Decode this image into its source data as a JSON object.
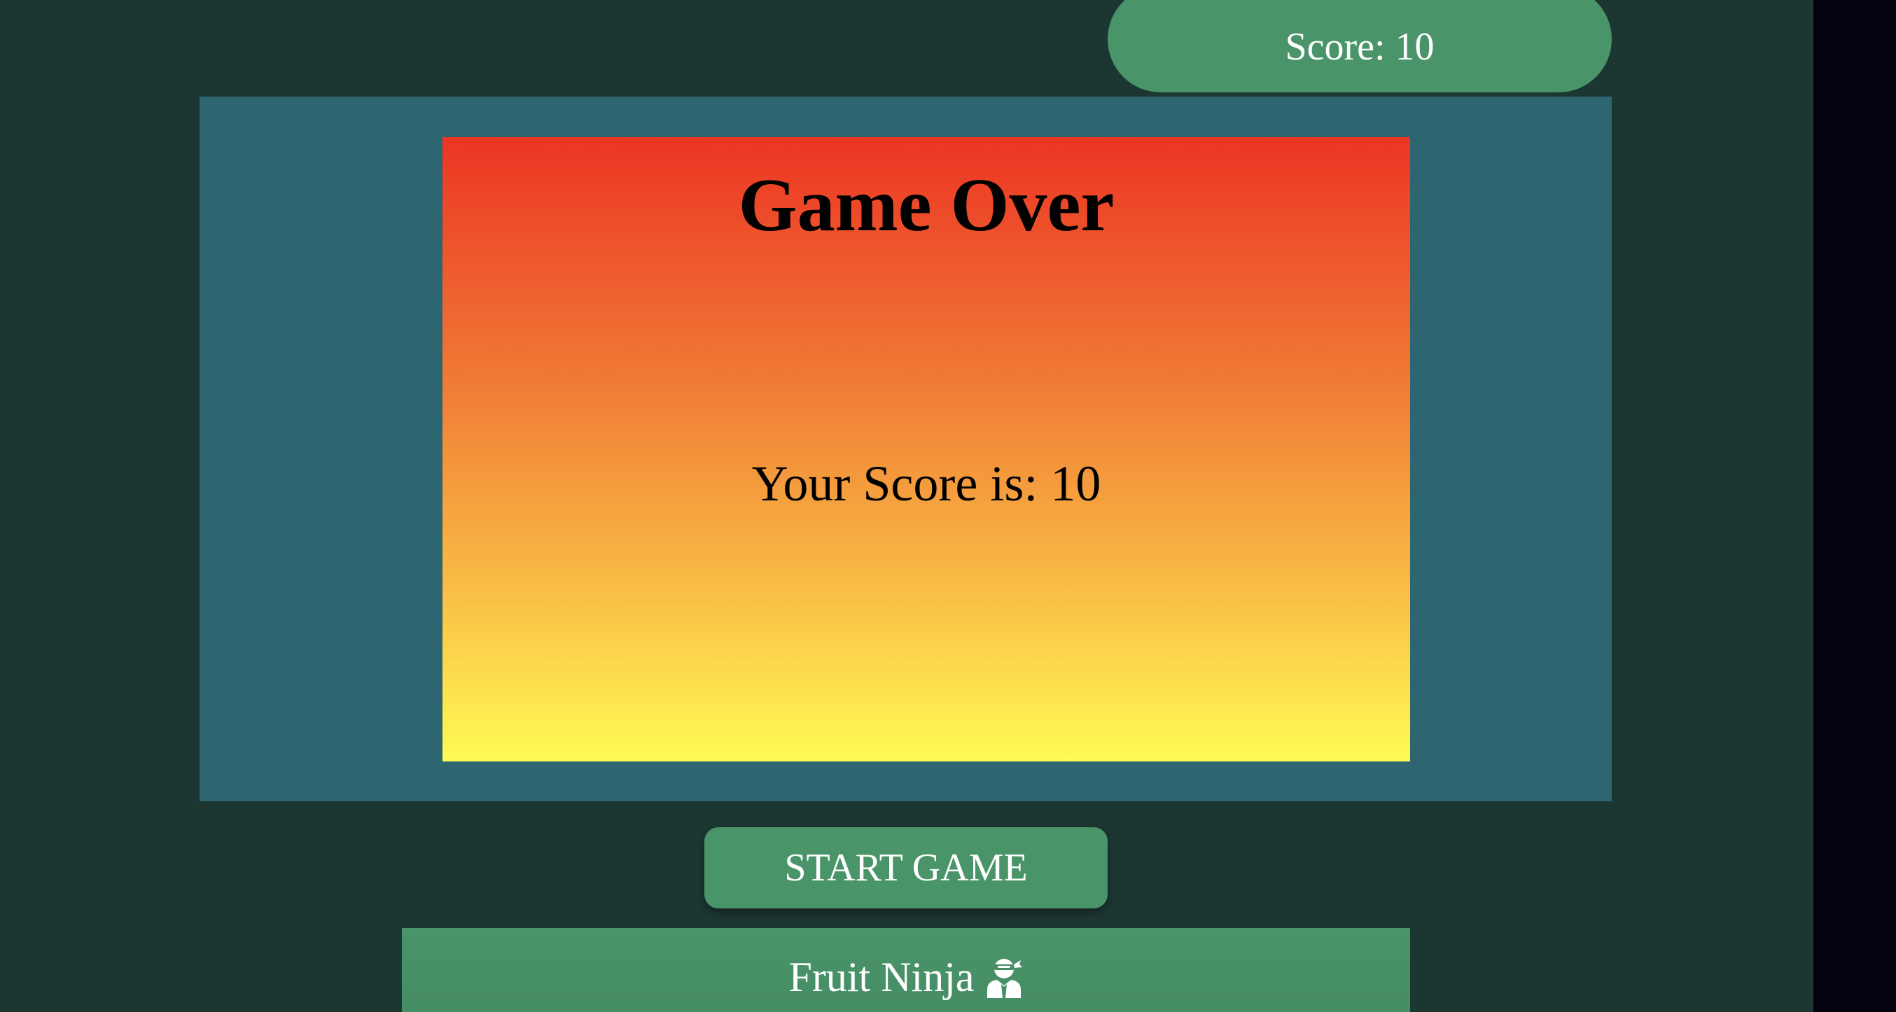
{
  "game": {
    "score_label": "Score: 10",
    "score_value": 10
  },
  "game_over": {
    "title": "Game Over",
    "final_score_text": "Your Score is: 10"
  },
  "controls": {
    "start_label": "START GAME"
  },
  "footer": {
    "title": "Fruit Ninja",
    "icon": "ninja-icon"
  },
  "colors": {
    "page_background": "#1c3632",
    "board_background": "#2d6570",
    "accent_green": "#4a9469",
    "gradient_top": "#ec3524",
    "gradient_bottom": "#fffb55",
    "text_light": "#ffffff",
    "side_strip": "#02030f"
  }
}
